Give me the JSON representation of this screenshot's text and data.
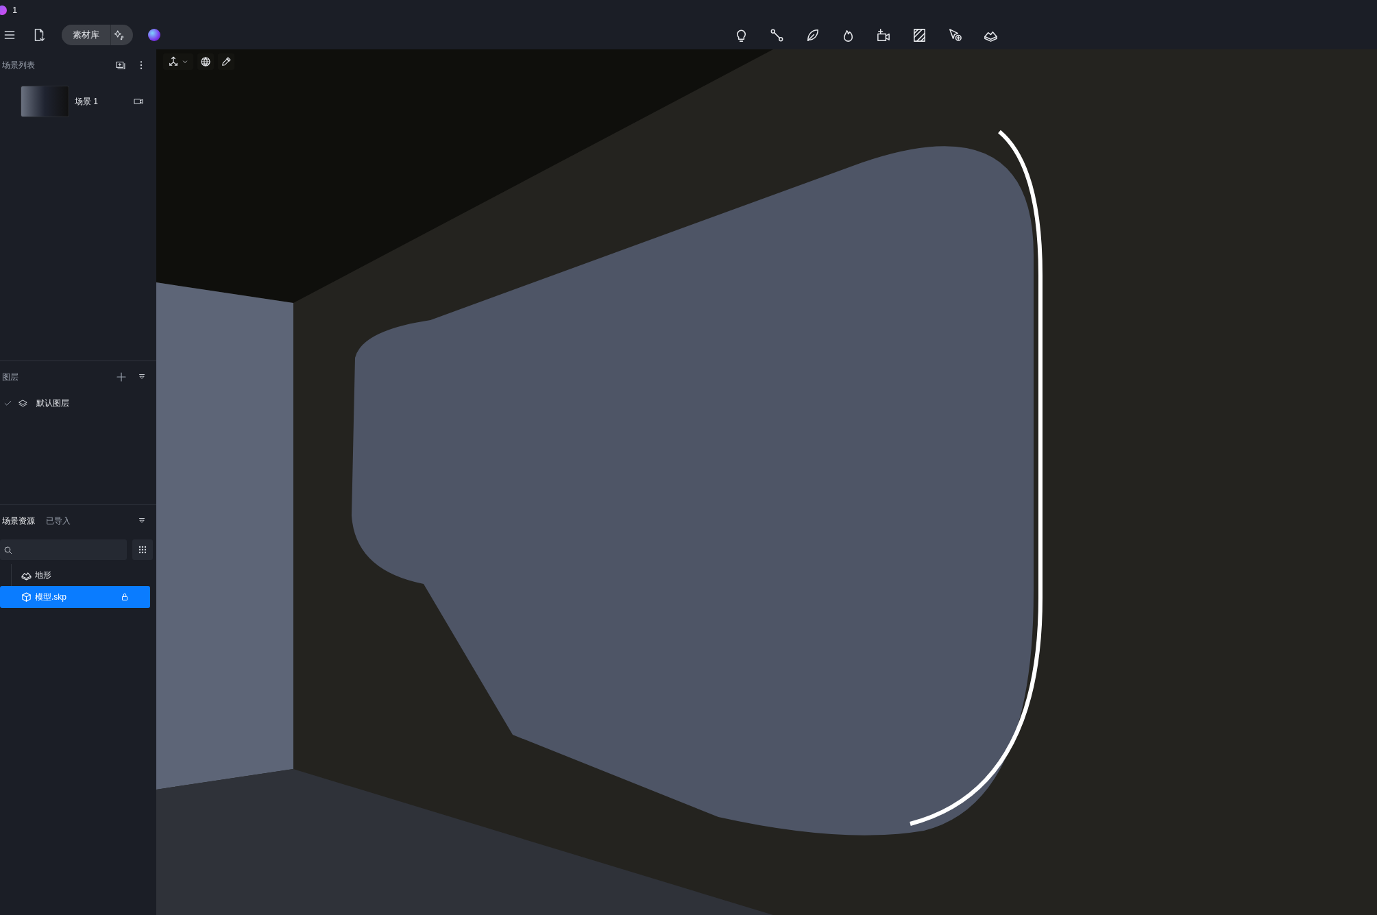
{
  "app": {
    "title": "1"
  },
  "toolbar": {
    "library_button": "素材库"
  },
  "scene_list": {
    "title": "场景列表",
    "scenes": [
      {
        "name": "场景 1",
        "selected": false
      }
    ]
  },
  "layers": {
    "title": "图层",
    "items": [
      {
        "name": "默认图层",
        "checked": true
      }
    ]
  },
  "assets": {
    "tabs": [
      {
        "label": "场景资源",
        "selected": true
      },
      {
        "label": "已导入",
        "selected": false
      }
    ],
    "tree": [
      {
        "name": "地形",
        "kind": "terrain",
        "selected": false,
        "locked": false
      },
      {
        "name": "模型.skp",
        "kind": "model",
        "selected": true,
        "locked": true
      }
    ]
  }
}
